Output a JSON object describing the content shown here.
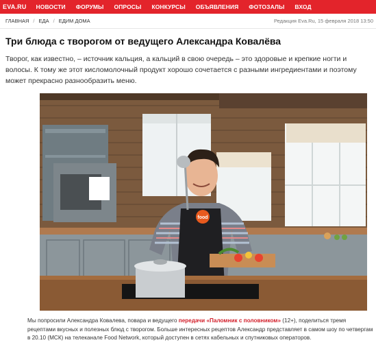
{
  "site": {
    "logo": "EVA.RU"
  },
  "nav": {
    "items": [
      "НОВОСТИ",
      "ФОРУМЫ",
      "ОПРОСЫ",
      "КОНКУРСЫ",
      "ОБЪЯВЛЕНИЯ",
      "ФОТОЗАЛЫ",
      "ВХОД"
    ]
  },
  "breadcrumb": {
    "items": [
      "ГЛАВНАЯ",
      "ЕДА",
      "ЕДИМ ДОМА"
    ],
    "meta": "Редакция Eva.Ru, 15 февраля 2018 13:50"
  },
  "article": {
    "title": "Три блюда с творогом от ведущего Александра Ковалёва",
    "lead": "Творог, как известно, – источник кальция, а кальций в свою очередь – это здоровые и крепкие ногти и волосы. К тому же этот кисломолочный продукт хорошо сочетается с разными ингредиентами и поэтому может прекрасно разнообразить меню.",
    "caption_pre": "Мы попросили Александра Ковалева, повара и ведущего ",
    "caption_link": "передачи «Паломник с половником»",
    "caption_post": " (12+), поделиться тремя рецептами вкусных и полезных блюд с творогом. Больше интересных рецептов Александр представляет в самом шоу по четвергам в 20.10 (МСК) на телеканале Food Network, который доступен в сетях кабельных и спутниковых операторов."
  },
  "photo": {
    "apron_logo": "food"
  },
  "colors": {
    "nav_bg": "#e3242b",
    "link": "#d21f2a"
  }
}
